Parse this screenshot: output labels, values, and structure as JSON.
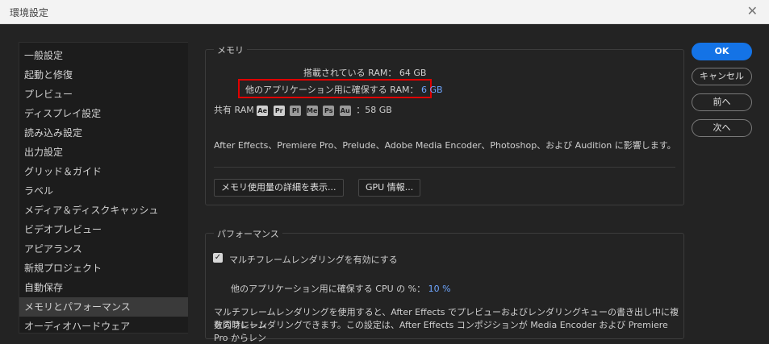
{
  "window": {
    "title": "環境設定",
    "close_glyph": "✕"
  },
  "sidebar": {
    "items": [
      {
        "label": "一般設定"
      },
      {
        "label": "起動と修復"
      },
      {
        "label": "プレビュー"
      },
      {
        "label": "ディスプレイ設定"
      },
      {
        "label": "読み込み設定"
      },
      {
        "label": "出力設定"
      },
      {
        "label": "グリッド＆ガイド"
      },
      {
        "label": "ラベル"
      },
      {
        "label": "メディア＆ディスクキャッシュ"
      },
      {
        "label": "ビデオプレビュー"
      },
      {
        "label": "アピアランス"
      },
      {
        "label": "新規プロジェクト"
      },
      {
        "label": "自動保存"
      },
      {
        "label": "メモリとパフォーマンス"
      },
      {
        "label": "オーディオハードウェア"
      }
    ],
    "selected_label": "メモリとパフォーマンス"
  },
  "memory": {
    "title": "メモリ",
    "installed_label": "搭載されている RAM：",
    "installed_value": "64 GB",
    "reserved_label": "他のアプリケーション用に確保する RAM：",
    "reserved_value": "6 GB",
    "shared_label": "共有 RAM",
    "apps": [
      "Ae",
      "Pr",
      "Pl",
      "Me",
      "Ps",
      "Au"
    ],
    "shared_value": "：58 GB",
    "note": "After Effects、Premiere Pro、Prelude、Adobe Media Encoder、Photoshop、および Audition に影響します。",
    "details_button": "メモリ使用量の詳細を表示...",
    "gpu_button": "GPU 情報..."
  },
  "performance": {
    "title": "パフォーマンス",
    "multiframe_label": "マルチフレームレンダリングを有効にする",
    "cpu_label": "他のアプリケーション用に確保する CPU の %：",
    "cpu_value": "10 %",
    "desc_line1": "マルチフレームレンダリングを使用すると、After Effects でプレビューおよびレンダリングキューの書き出し中に複数のフレーム",
    "desc_line2": "を同時にレンダリングできます。この設定は、After Effects コンポジションが Media Encoder および Premiere Pro からレン"
  },
  "buttons": {
    "ok": "OK",
    "cancel": "キャンセル",
    "prev": "前へ",
    "next": "次へ"
  },
  "colors": {
    "accent": "#1473e6",
    "value_blue": "#6ea6ff",
    "highlight": "#e00000"
  }
}
